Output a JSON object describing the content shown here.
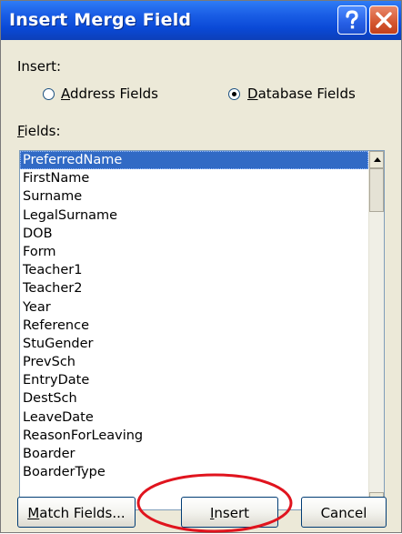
{
  "window": {
    "title": "Insert Merge Field"
  },
  "insert_group": {
    "label": "Insert:",
    "options": [
      {
        "label_mnemonic": "A",
        "label_rest": "ddress Fields",
        "selected": false
      },
      {
        "label_mnemonic": "D",
        "label_rest": "atabase Fields",
        "selected": true
      }
    ]
  },
  "fields": {
    "label_mnemonic": "F",
    "label_rest": "ields:",
    "selected": "PreferredName",
    "items": [
      "PreferredName",
      "FirstName",
      "Surname",
      "LegalSurname",
      "DOB",
      "Form",
      "Teacher1",
      "Teacher2",
      "Year",
      "Reference",
      "StuGender",
      "PrevSch",
      "EntryDate",
      "DestSch",
      "LeaveDate",
      "ReasonForLeaving",
      "Boarder",
      "BoarderType"
    ]
  },
  "buttons": {
    "match_mnemonic": "M",
    "match_rest": "atch Fields...",
    "insert_mnemonic": "I",
    "insert_rest": "nsert",
    "cancel": "Cancel"
  },
  "colors": {
    "titlebar": "#0a49d6",
    "selection": "#316ac5",
    "annotation_circle": "#e0141e"
  },
  "icons": {
    "help": "help-icon",
    "close": "close-icon"
  }
}
